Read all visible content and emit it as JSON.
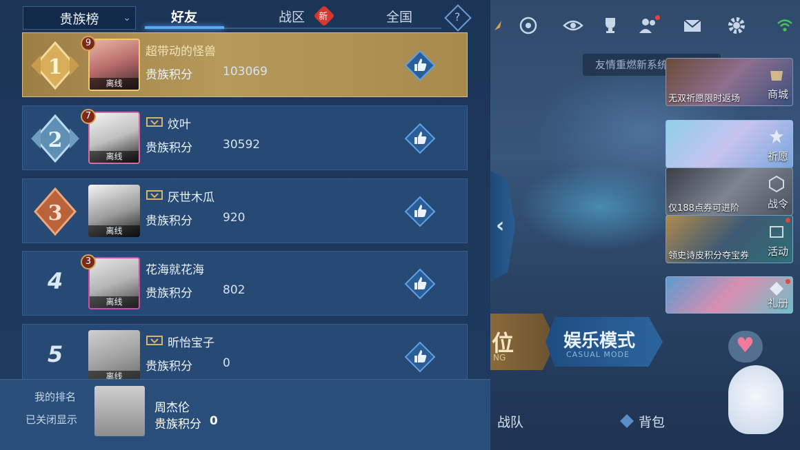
{
  "tabs": {
    "dropdown_label": "贵族榜",
    "friends": "好友",
    "region": "战区",
    "region_badge": "新",
    "national": "全国",
    "help": "?"
  },
  "rows": [
    {
      "rank": "1",
      "level": "9",
      "name": "超带动的怪兽",
      "score_label": "贵族积分",
      "score": "103069",
      "status": "离线"
    },
    {
      "rank": "2",
      "level": "7",
      "name": "炆叶",
      "score_label": "贵族积分",
      "score": "30592",
      "status": "离线"
    },
    {
      "rank": "3",
      "level": "",
      "name": "厌世木瓜",
      "score_label": "贵族积分",
      "score": "920",
      "status": "离线"
    },
    {
      "rank": "4",
      "level": "3",
      "name": "花海就花海",
      "score_label": "贵族积分",
      "score": "802",
      "status": "离线"
    },
    {
      "rank": "5",
      "level": "",
      "name": "昕怡宝子",
      "score_label": "贵族积分",
      "score": "0",
      "status": "离线"
    }
  ],
  "my_rank": {
    "title": "我的排名",
    "status": "已关闭显示",
    "name": "周杰伦",
    "score_label": "贵族积分",
    "score": "0"
  },
  "scene": {
    "notice": "友情重燃新系统上线",
    "promos": [
      {
        "caption": "无双祈愿限时返场",
        "label": "商城"
      },
      {
        "caption": "",
        "label": "祈愿"
      },
      {
        "caption": "仅188点券可进阶",
        "label": "战令"
      },
      {
        "caption": "领史诗皮积分夺宝券",
        "label": "活动"
      },
      {
        "caption": "",
        "label": "礼册"
      }
    ],
    "mode_left": "位",
    "mode_left_sub": "NG",
    "mode_right": "娱乐模式",
    "mode_right_sub": "CASUAL MODE",
    "bottom_team": "战队",
    "bottom_bag": "背包"
  },
  "colors": {
    "panel": "#1f3b60",
    "row": "#264a73",
    "gold_row": "#b59a5c",
    "accent": "#5aa8ff",
    "badge_red": "#d6382f"
  }
}
